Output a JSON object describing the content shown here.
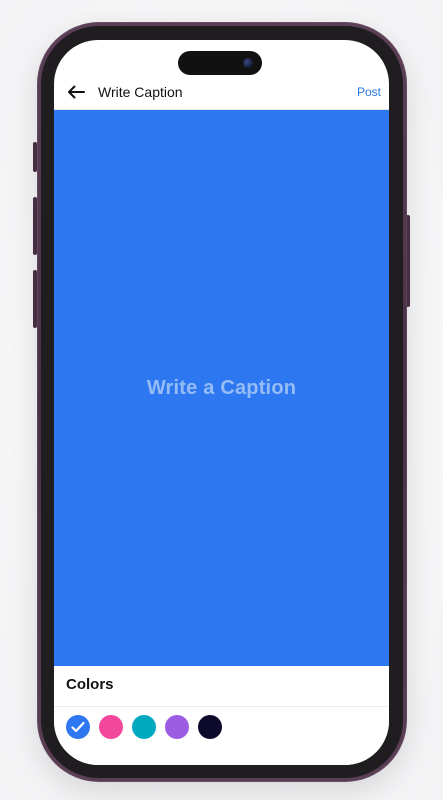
{
  "header": {
    "title": "Write Caption",
    "post_label": "Post"
  },
  "canvas": {
    "placeholder": "Write a Caption",
    "background_color": "#2D78F0",
    "text_color": "#FFFFFF80"
  },
  "colors": {
    "heading": "Colors",
    "selected_index": 0,
    "swatches": [
      {
        "name": "blue",
        "hex": "#2D78F0"
      },
      {
        "name": "pink",
        "hex": "#F2489B"
      },
      {
        "name": "teal",
        "hex": "#00A9BF"
      },
      {
        "name": "purple",
        "hex": "#9B5CE3"
      },
      {
        "name": "navy",
        "hex": "#0D0A2B"
      }
    ]
  },
  "icons": {
    "back": "arrow-left-icon",
    "selected": "check-icon"
  },
  "theme": {
    "accent": "#2A7AE2"
  }
}
